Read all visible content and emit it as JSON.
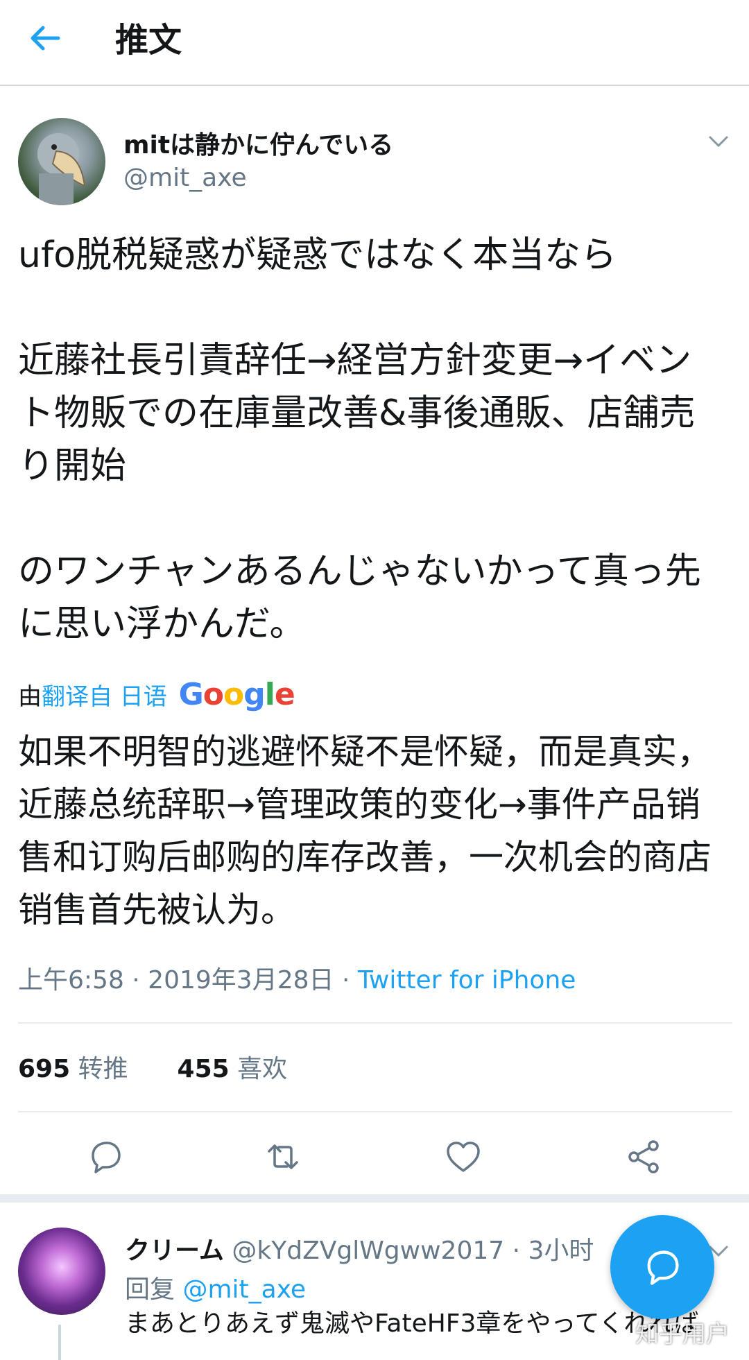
{
  "header": {
    "title": "推文"
  },
  "tweet": {
    "author_name": "mitは静かに佇んでいる",
    "author_handle": "@mit_axe",
    "text": "ufo脱税疑惑が疑惑ではなく本当なら\n\n近藤社長引責辞任→経営方針変更→イベント物販での在庫量改善&事後通販、店舗売り開始\n\nのワンチャンあるんじゃないかって真っ先に思い浮かんだ。",
    "translate_prefix": "由",
    "translate_link": "翻译自 日语",
    "translate_provider": "Google",
    "translation": "如果不明智的逃避怀疑不是怀疑，而是真实，近藤总统辞职→管理政策的变化→事件产品销售和订购后邮购的库存改善，一次机会的商店销售首先被认为。",
    "timestamp": "上午6:58 · 2019年3月28日 · ",
    "source": "Twitter for iPhone",
    "retweets_count": "695",
    "retweets_label": "转推",
    "likes_count": "455",
    "likes_label": "喜欢"
  },
  "reply": {
    "author_name": "クリーム",
    "author_handle": "@kYdZVglWgww2017",
    "time": " · 3小时",
    "reply_prefix": "回复 ",
    "reply_to": "@mit_axe",
    "text": "まあとりあえず鬼滅やFateHF3章をやってくれれば"
  },
  "watermark": "知乎用户",
  "colors": {
    "accent": "#1da1f2",
    "secondary_text": "#657786",
    "divider": "#e6ecf0"
  }
}
